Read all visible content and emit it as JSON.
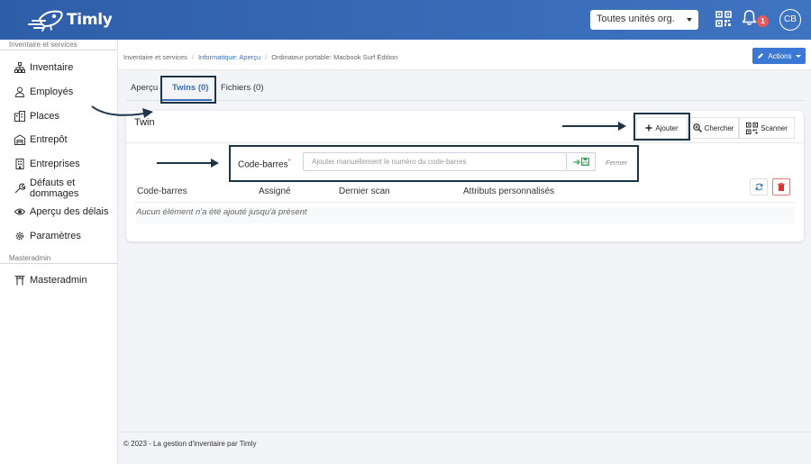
{
  "header": {
    "logo_text": "Timly",
    "org_select": "Toutes unités org.",
    "notification_count": "1",
    "avatar_initials": "CB",
    "brand_color": "#3a6db8"
  },
  "sidebar": {
    "section1": "Inventaire et services",
    "items": [
      {
        "label": "Inventaire",
        "icon": "sitemap-icon"
      },
      {
        "label": "Employés",
        "icon": "user-icon"
      },
      {
        "label": "Places",
        "icon": "building-icon"
      },
      {
        "label": "Entrepôt",
        "icon": "warehouse-icon"
      },
      {
        "label": "Entreprises",
        "icon": "company-icon"
      },
      {
        "label": "Défauts et dommages",
        "icon": "wrench-icon"
      },
      {
        "label": "Aperçu des délais",
        "icon": "eye-icon"
      },
      {
        "label": "Paramètres",
        "icon": "gear-icon"
      }
    ],
    "section2": "Masteradmin",
    "admin_item": {
      "label": "Masteradmin",
      "icon": "torii-icon"
    }
  },
  "breadcrumb": {
    "root": "Inventaire et services",
    "category": "Informatique: Aperçu",
    "current": "Ordinateur portable: Macbook Surf Édition"
  },
  "actions_label": "Actions",
  "tabs": [
    {
      "label": "Aperçu"
    },
    {
      "label": "Twins (0)"
    },
    {
      "label": "Fichiers (0)"
    }
  ],
  "card": {
    "title": "Twin",
    "add_label": "Ajouter",
    "search_label": "Chercher",
    "scan_label": "Scanner",
    "barcode_label": "Code-barres",
    "barcode_required": "*",
    "barcode_placeholder": "Ajouter manuellement le numéro du code-barres",
    "barcode_value": "",
    "close_label": "Fermer",
    "columns": [
      "Code-barres",
      "Assigné",
      "Dernier scan",
      "Attributs personnalisés"
    ],
    "empty_message": "Aucun élément n'a été ajouté jusqu'à présent"
  },
  "footer": "© 2023 - La gestion d'inventaire par Timly"
}
